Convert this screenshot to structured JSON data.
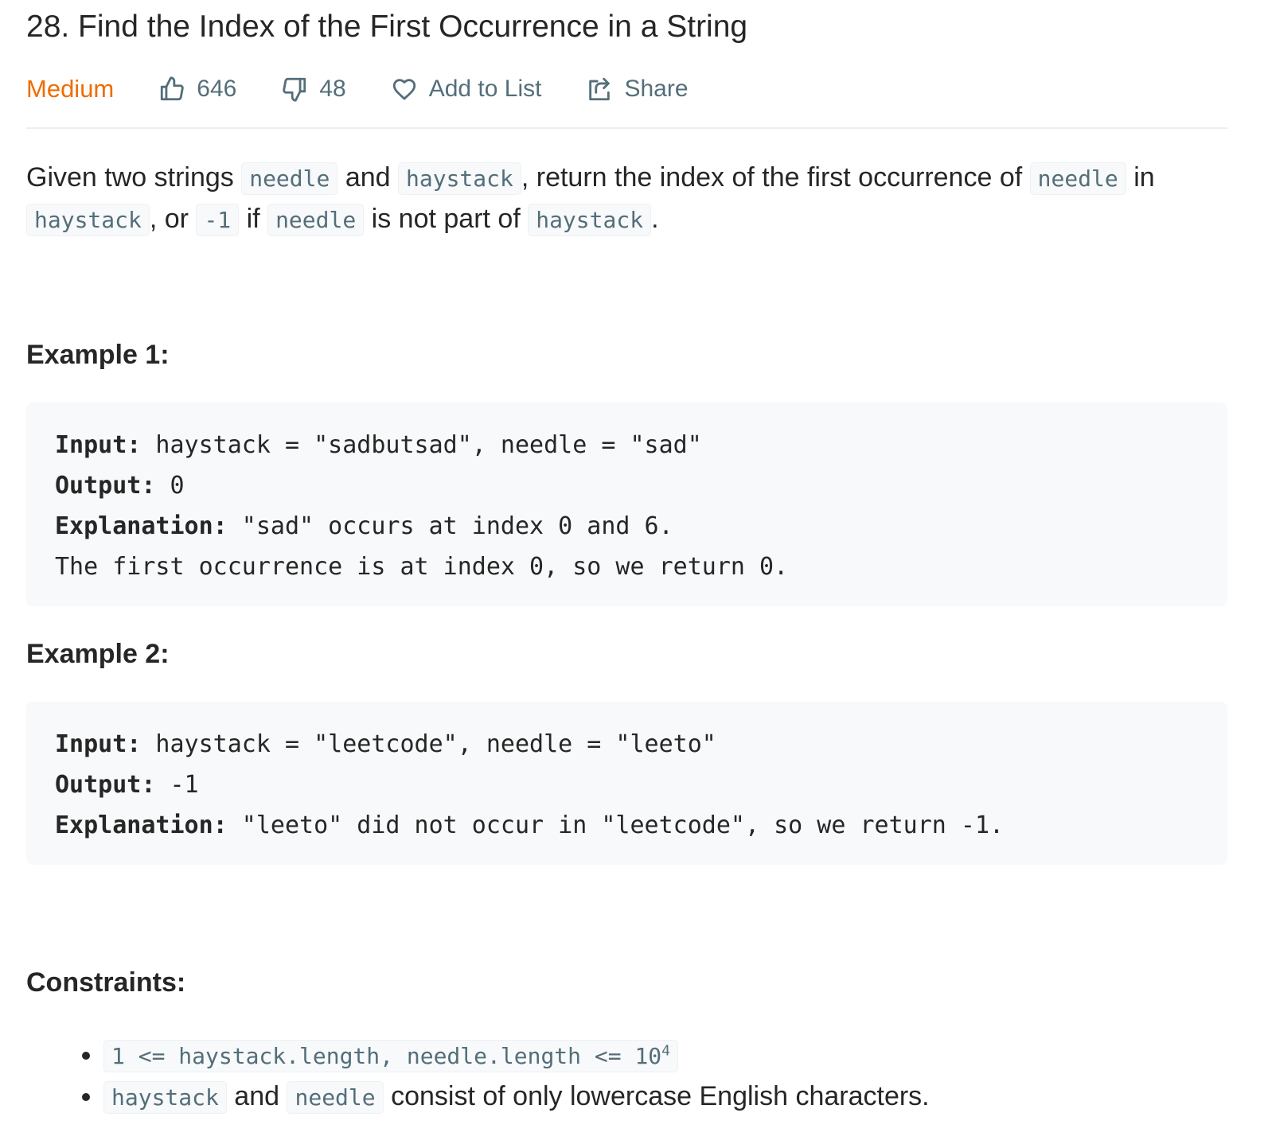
{
  "problem": {
    "title": "28. Find the Index of the First Occurrence in a String",
    "difficulty": "Medium",
    "likes": "646",
    "dislikes": "48",
    "add_to_list": "Add to List",
    "share": "Share"
  },
  "description": {
    "t1": "Given two strings ",
    "c1": "needle",
    "t2": " and ",
    "c2": "haystack",
    "t3": ", return the index of the first occurrence of ",
    "c3": "needle",
    "t4": " in ",
    "c4": "haystack",
    "t5": ", or ",
    "c5": "-1",
    "t6": " if ",
    "c6": "needle",
    "t7": " is not part of ",
    "c7": "haystack",
    "t8": "."
  },
  "examples": [
    {
      "heading": "Example 1:",
      "input_label": "Input:",
      "input_value": " haystack = \"sadbutsad\", needle = \"sad\"",
      "output_label": "Output:",
      "output_value": " 0",
      "explanation_label": "Explanation:",
      "explanation_value": " \"sad\" occurs at index 0 and 6.",
      "extra_line": "The first occurrence is at index 0, so we return 0."
    },
    {
      "heading": "Example 2:",
      "input_label": "Input:",
      "input_value": " haystack = \"leetcode\", needle = \"leeto\"",
      "output_label": "Output:",
      "output_value": " -1",
      "explanation_label": "Explanation:",
      "explanation_value": " \"leeto\" did not occur in \"leetcode\", so we return -1."
    }
  ],
  "constraints": {
    "heading": "Constraints:",
    "c1_code": "1 <= haystack.length, needle.length <= 10",
    "c1_sup": "4",
    "c2_code_a": "haystack",
    "c2_text_a": " and ",
    "c2_code_b": "needle",
    "c2_text_b": " consist of only lowercase English characters."
  },
  "colors": {
    "difficulty_medium": "#ef6c00",
    "meta_gray": "#546e7a",
    "code_bg": "#f7f9fa",
    "text": "#262626"
  },
  "icons": {
    "like": "thumbs-up-icon",
    "dislike": "thumbs-down-icon",
    "favorite": "heart-icon",
    "share": "share-icon"
  }
}
